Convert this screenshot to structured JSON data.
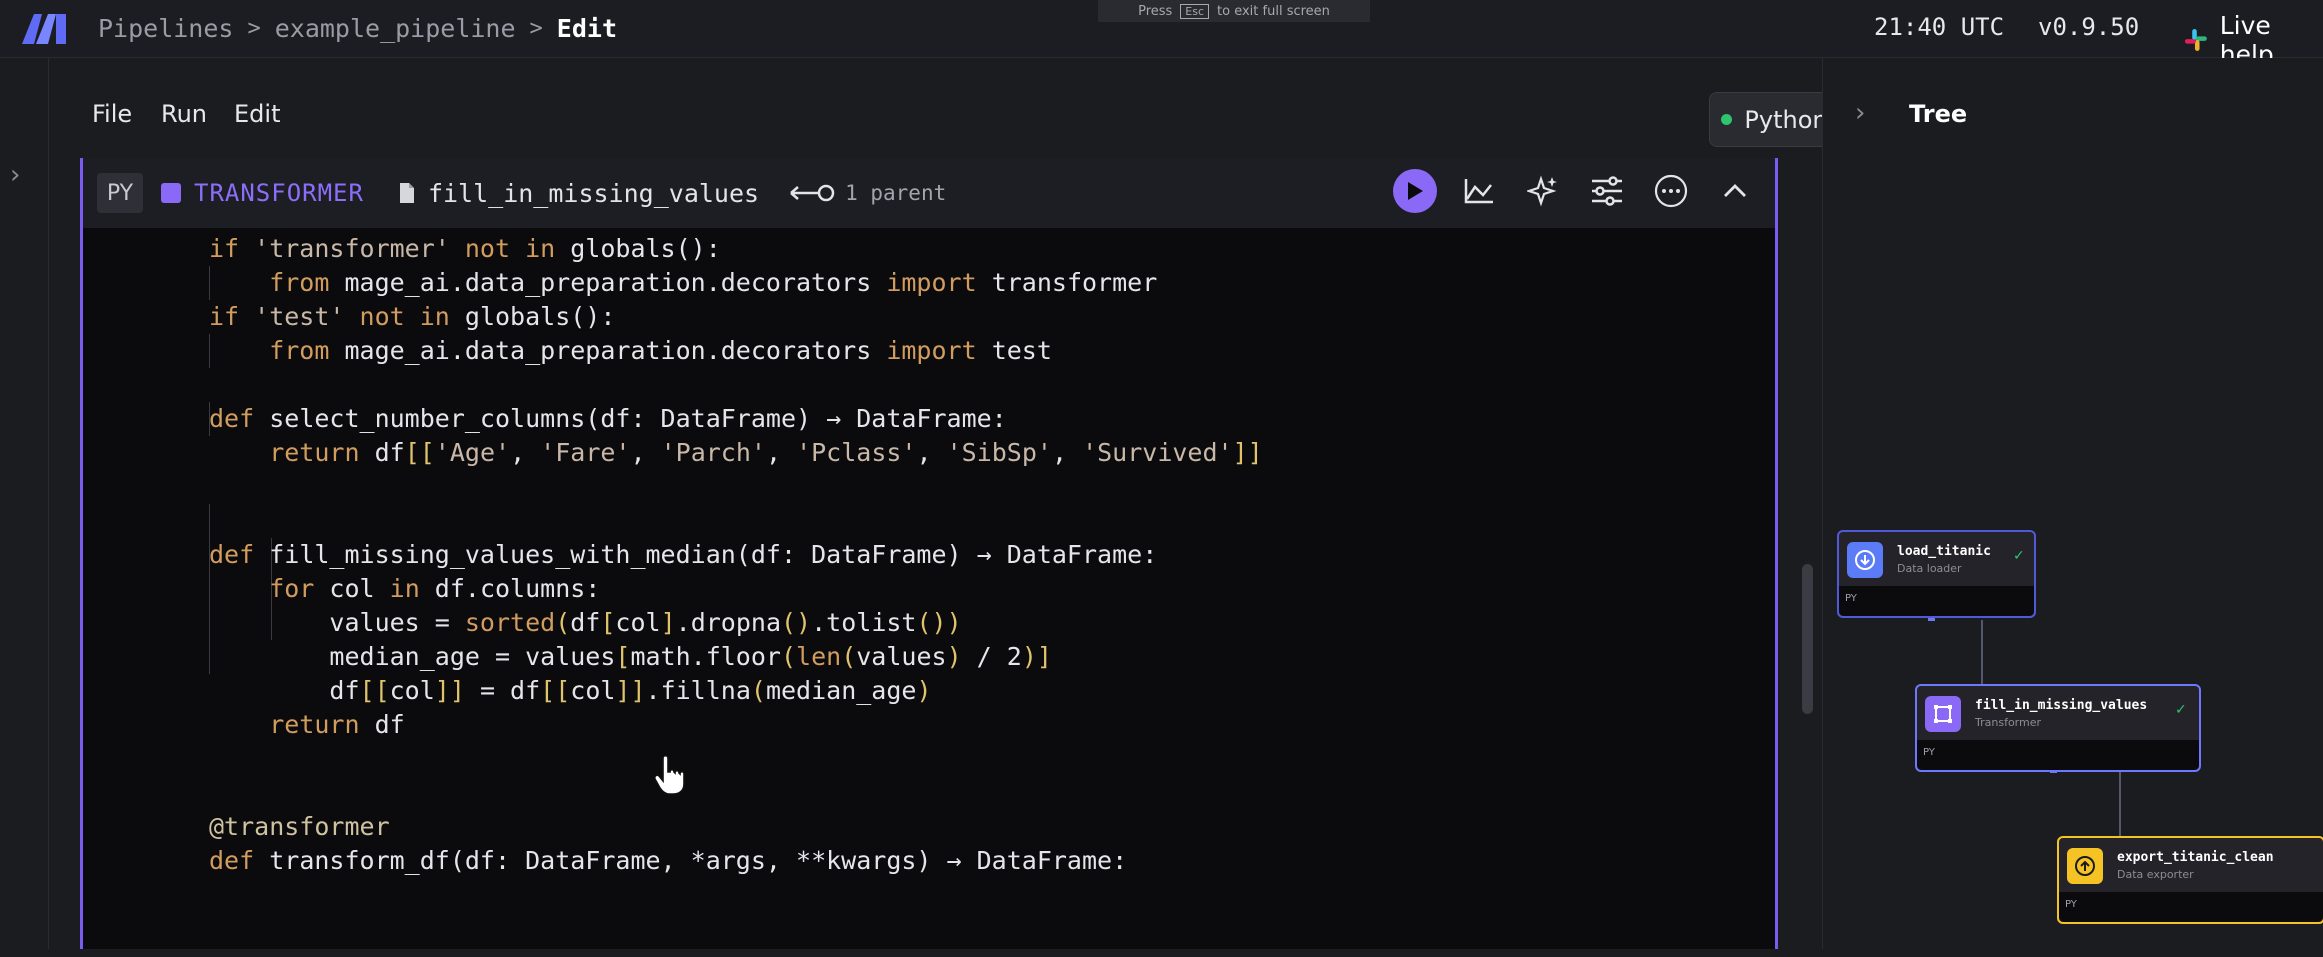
{
  "topbar": {
    "breadcrumbs": [
      "Pipelines",
      "example_pipeline",
      "Edit"
    ],
    "fullscreen_hint": {
      "before": "Press",
      "key": "Esc",
      "after": "to exit full screen"
    },
    "clock": "21:40 UTC",
    "version": "v0.9.50",
    "live_help": "Live help"
  },
  "menubar": {
    "items": [
      "File",
      "Run",
      "Edit"
    ],
    "kernel_label": "Python",
    "kernel_status_color": "#2ec56e"
  },
  "block": {
    "language_tag": "PY",
    "type_label": "TRANSFORMER",
    "name": "fill_in_missing_values",
    "parents_label": "1 parent",
    "accent_color": "#8b69f7",
    "toolbar_icons": [
      "run-icon",
      "chart-icon",
      "ai-sparkle-icon",
      "settings-sliders-icon",
      "more-icon",
      "collapse-icon"
    ]
  },
  "code_lines": [
    "if 'transformer' not in globals():",
    "    from mage_ai.data_preparation.decorators import transformer",
    "if 'test' not in globals():",
    "    from mage_ai.data_preparation.decorators import test",
    "",
    "def select_number_columns(df: DataFrame) → DataFrame:",
    "    return df[['Age', 'Fare', 'Parch', 'Pclass', 'SibSp', 'Survived']]",
    "",
    "",
    "def fill_missing_values_with_median(df: DataFrame) → DataFrame:",
    "    for col in df.columns:",
    "        values = sorted(df[col].dropna().tolist())",
    "        median_age = values[math.floor(len(values) / 2)]",
    "        df[[col]] = df[[col]].fillna(median_age)",
    "    return df",
    "",
    "",
    "@transformer",
    "def transform_df(df: DataFrame, *args, **kwargs) → DataFrame:"
  ],
  "tree": {
    "title": "Tree",
    "nodes": [
      {
        "name": "load_titanic",
        "type": "Data loader",
        "lang": "PY",
        "icon": "download-icon",
        "color": "#5b7cf6"
      },
      {
        "name": "fill_in_missing_values",
        "type": "Transformer",
        "lang": "PY",
        "icon": "transform-icon",
        "color": "#8b69f7"
      },
      {
        "name": "export_titanic_clean",
        "type": "Data exporter",
        "lang": "PY",
        "icon": "upload-icon",
        "color": "#f6c324"
      }
    ]
  }
}
